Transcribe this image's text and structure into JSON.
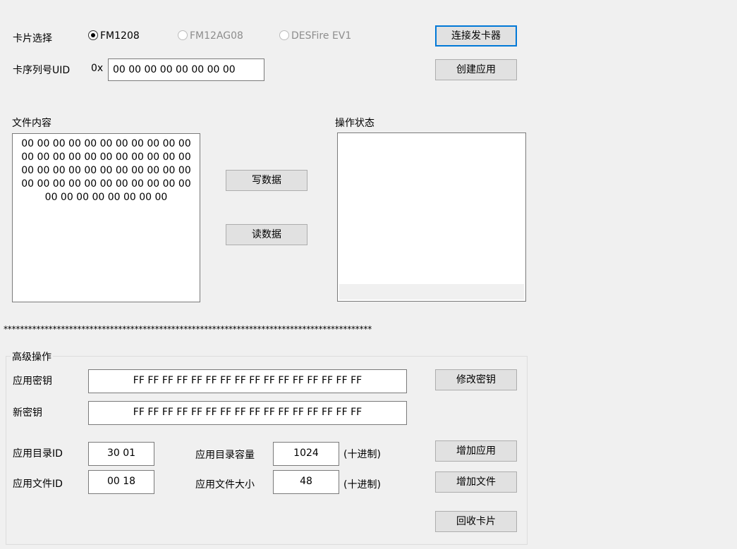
{
  "card_select": {
    "label": "卡片选择",
    "options": [
      {
        "label": "FM1208",
        "selected": true,
        "enabled": true
      },
      {
        "label": "FM12AG08",
        "selected": false,
        "enabled": false
      },
      {
        "label": "DESFire EV1",
        "selected": false,
        "enabled": false
      }
    ]
  },
  "uid": {
    "label": "卡序列号UID",
    "prefix": "0x",
    "value": "00 00 00 00 00 00 00 00"
  },
  "buttons": {
    "connect": "连接发卡器",
    "create_app": "创建应用",
    "write": "写数据",
    "read": "读数据",
    "change_key": "修改密钥",
    "add_app": "增加应用",
    "add_file": "增加文件",
    "recycle": "回收卡片"
  },
  "file_content": {
    "label": "文件内容",
    "lines": [
      "00 00 00 00 00 00 00 00 00 00 00",
      "00 00 00 00 00 00 00 00 00 00 00",
      "00 00 00 00 00 00 00 00 00 00 00",
      "00 00 00 00 00 00 00 00 00 00 00",
      "00 00 00 00 00 00 00 00"
    ]
  },
  "status": {
    "label": "操作状态"
  },
  "separator": "******************************************************************************************",
  "advanced": {
    "label": "高级操作",
    "app_key_label": "应用密钥",
    "app_key": "FF FF FF FF FF FF FF FF FF FF FF FF FF FF FF FF",
    "new_key_label": "新密钥",
    "new_key": "FF FF FF FF FF FF FF FF FF FF FF FF FF FF FF FF",
    "dir_id_label": "应用目录ID",
    "dir_id": "30 01",
    "dir_cap_label": "应用目录容量",
    "dir_cap": "1024",
    "decimal": "(十进制)",
    "file_id_label": "应用文件ID",
    "file_id": "00 18",
    "file_size_label": "应用文件大小",
    "file_size": "48"
  }
}
